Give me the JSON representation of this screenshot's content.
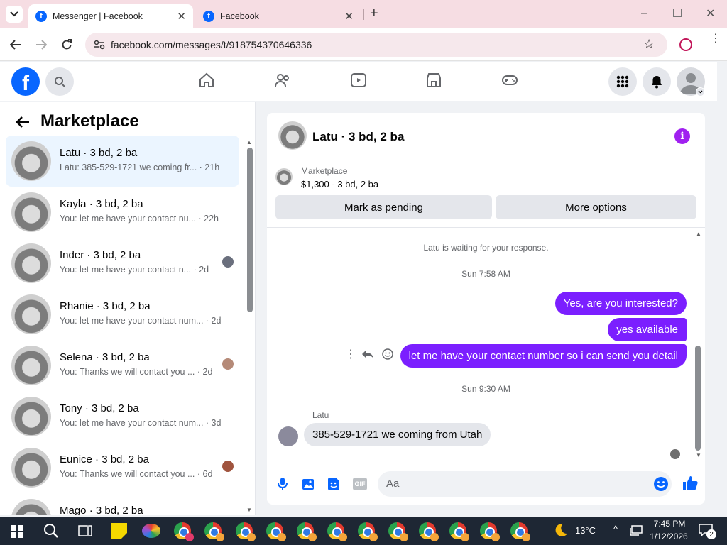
{
  "browser": {
    "tabs": [
      {
        "title": "Messenger | Facebook",
        "active": true
      },
      {
        "title": "Facebook",
        "active": false
      }
    ],
    "url": "facebook.com/messages/t/918754370646336"
  },
  "left_panel": {
    "title": "Marketplace",
    "conversations": [
      {
        "name": "Latu · 3 bd, 2 ba",
        "preview": "Latu: 385-529-1721 we coming fr...",
        "time": "· 21h",
        "selected": true
      },
      {
        "name": "Kayla · 3 bd, 2 ba",
        "preview": "You: let me have your contact nu...",
        "time": "· 22h"
      },
      {
        "name": "Inder · 3 bd, 2 ba",
        "preview": "You: let me have your contact n...",
        "time": "· 2d"
      },
      {
        "name": "Rhanie · 3 bd, 2 ba",
        "preview": "You: let me have your contact num...",
        "time": "· 2d"
      },
      {
        "name": "Selena · 3 bd, 2 ba",
        "preview": "You: Thanks we will contact you ...",
        "time": "· 2d"
      },
      {
        "name": "Tony · 3 bd, 2 ba",
        "preview": "You: let me have your contact num...",
        "time": "· 3d"
      },
      {
        "name": "Eunice · 3 bd, 2 ba",
        "preview": "You: Thanks we will contact you ...",
        "time": "· 6d"
      },
      {
        "name": "Mago · 3 bd, 2 ba",
        "preview": "",
        "time": ""
      }
    ]
  },
  "chat": {
    "header_title": "Latu · 3 bd, 2 ba",
    "listing_label": "Marketplace",
    "listing_detail": "$1,300 - 3 bd, 2 ba",
    "mark_pending": "Mark as pending",
    "more_options": "More options",
    "waiting_text": "Latu is waiting for your response.",
    "time1": "Sun 7:58 AM",
    "time2": "Sun 9:30 AM",
    "msg_out_1": "Yes, are you interested?",
    "msg_out_2": "yes available",
    "msg_out_3": "let me have your contact number so i can send you detail",
    "sender_name": "Latu",
    "msg_in_1": "385-529-1721 we coming from Utah",
    "composer_placeholder": "Aa"
  },
  "taskbar": {
    "weather": "13°C",
    "time": "7:45 PM",
    "date": "1/12/2026",
    "notifications": "2"
  }
}
